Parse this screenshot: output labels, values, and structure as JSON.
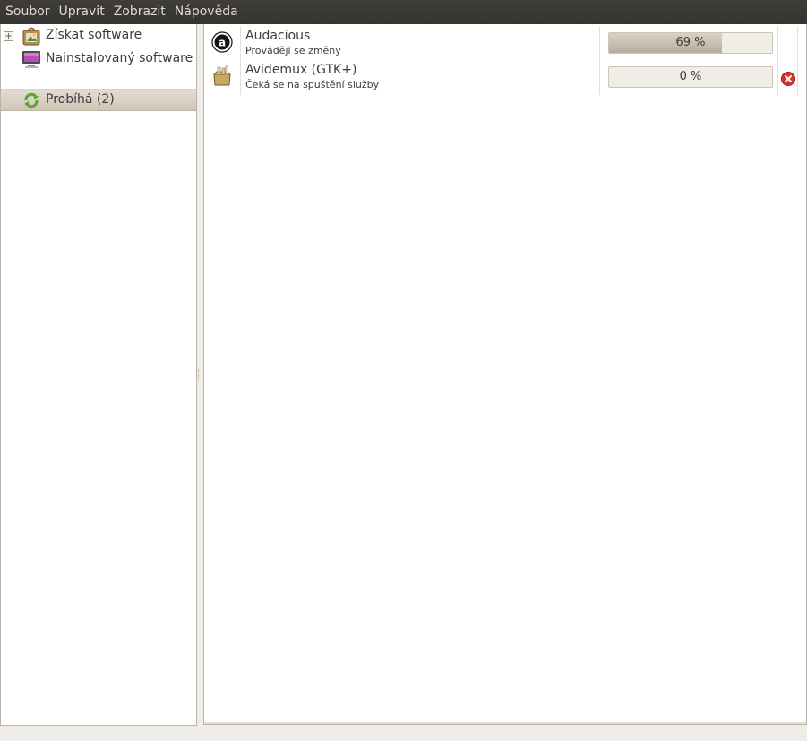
{
  "menubar": {
    "items": [
      {
        "label": "Soubor"
      },
      {
        "label": "Upravit"
      },
      {
        "label": "Zobrazit"
      },
      {
        "label": "Nápověda"
      }
    ]
  },
  "sidebar": {
    "items": [
      {
        "label": "Získat software",
        "icon": "software-center-icon",
        "expander": "+"
      },
      {
        "label": "Nainstalovaný software",
        "icon": "monitor-icon"
      },
      {
        "label": "Probíhá (2)",
        "icon": "refresh-icon",
        "selected": true
      }
    ]
  },
  "transactions": [
    {
      "name": "Audacious",
      "status": "Provádějí se změny",
      "icon": "audacious-icon",
      "progress_text": "69 %",
      "progress": 0.69,
      "cancelable": false
    },
    {
      "name": "Avidemux (GTK+)",
      "status": "Čeká se na spuštění služby",
      "icon": "package-icon",
      "progress_text": "0 %",
      "progress": 0,
      "cancelable": true
    }
  ],
  "colors": {
    "menubar_bg": "#3c3a35",
    "menubar_text": "#dfdbd2",
    "selection_bg": "#d6cec2",
    "progress_fill": "#c2b6a6",
    "cancel_red": "#d8322a"
  }
}
